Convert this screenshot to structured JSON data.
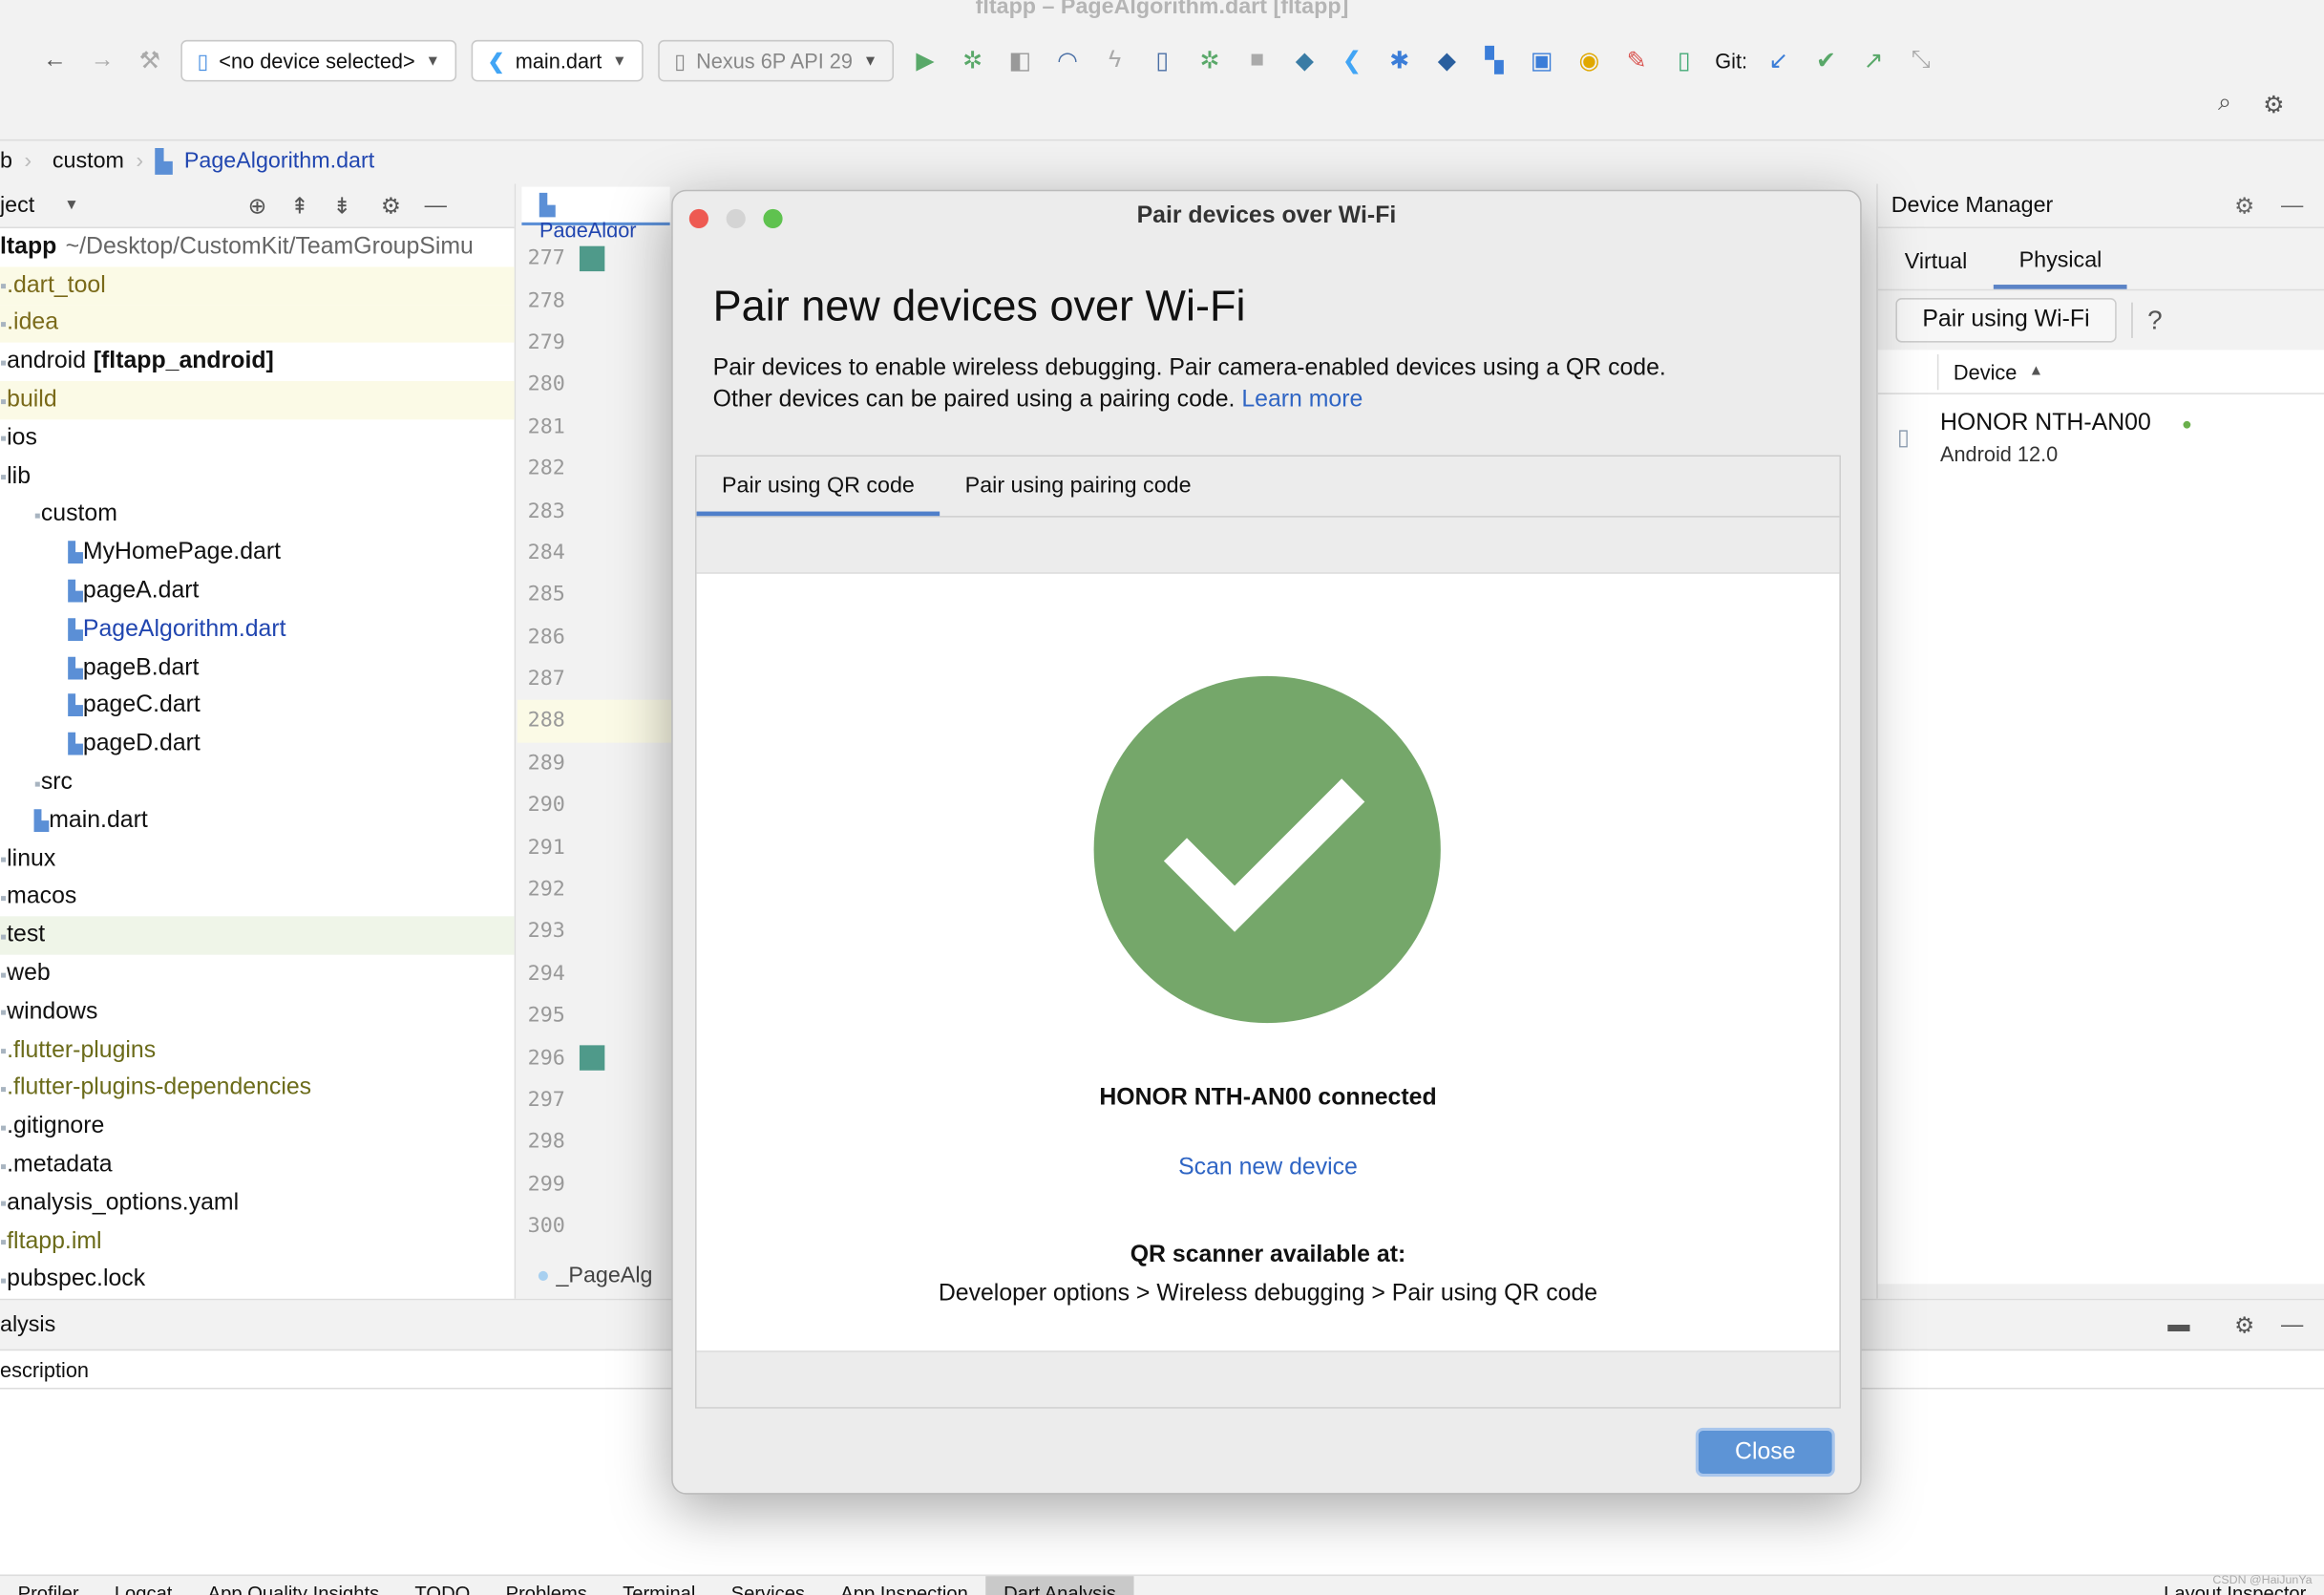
{
  "window_title": "fltapp – PageAlgorithm.dart [fltapp]",
  "toolbar": {
    "device_select": "<no device selected>",
    "run_config": "main.dart",
    "emulator": "Nexus 6P API 29",
    "git_label": "Git:",
    "icons": [
      "back-arrow-icon",
      "forward-arrow-icon",
      "build-icon",
      "run-icon",
      "debug-icon",
      "coverage-icon",
      "profile-icon",
      "hot-reload-icon",
      "device-file-icon",
      "attach-debugger-icon",
      "stop-icon",
      "gradle-sync-icon",
      "flutter-icon",
      "bug-icon",
      "dart-devtools-icon",
      "structure-icon",
      "sdk-manager-icon",
      "performance-icon",
      "clean-icon",
      "device-mirror-icon"
    ]
  },
  "breadcrumb": [
    "b",
    "custom",
    "PageAlgorithm.dart"
  ],
  "project_panel": {
    "title": "ject",
    "root_name": "ltapp",
    "root_path": "~/Desktop/CustomKit/TeamGroupSimu",
    "items": [
      {
        "label": ".dart_tool",
        "color": "#7a6a1a",
        "bg": "#fbfae6",
        "indent": 0
      },
      {
        "label": ".idea",
        "color": "#7a6a1a",
        "bg": "#fbfae6",
        "indent": 0
      },
      {
        "label": "android",
        "suffix": "[fltapp_android]",
        "color": "#111",
        "bg": "",
        "indent": 0
      },
      {
        "label": "build",
        "color": "#7a6a1a",
        "bg": "#fbfae6",
        "indent": 0
      },
      {
        "label": "ios",
        "color": "#111",
        "bg": "",
        "indent": 0
      },
      {
        "label": "lib",
        "color": "#111",
        "bg": "",
        "indent": 0
      },
      {
        "label": "custom",
        "color": "#111",
        "bg": "",
        "indent": 1
      },
      {
        "label": "MyHomePage.dart",
        "color": "#111",
        "bg": "",
        "indent": 2
      },
      {
        "label": "pageA.dart",
        "color": "#111",
        "bg": "",
        "indent": 2
      },
      {
        "label": "PageAlgorithm.dart",
        "color": "#2146b0",
        "bg": "",
        "indent": 2
      },
      {
        "label": "pageB.dart",
        "color": "#111",
        "bg": "",
        "indent": 2
      },
      {
        "label": "pageC.dart",
        "color": "#111",
        "bg": "",
        "indent": 2
      },
      {
        "label": "pageD.dart",
        "color": "#111",
        "bg": "",
        "indent": 2
      },
      {
        "label": "src",
        "color": "#111",
        "bg": "",
        "indent": 1
      },
      {
        "label": "main.dart",
        "color": "#111",
        "bg": "",
        "indent": 1
      },
      {
        "label": "linux",
        "color": "#111",
        "bg": "",
        "indent": 0
      },
      {
        "label": "macos",
        "color": "#111",
        "bg": "",
        "indent": 0
      },
      {
        "label": "test",
        "color": "#111",
        "bg": "#eff5e8",
        "indent": 0
      },
      {
        "label": "web",
        "color": "#111",
        "bg": "",
        "indent": 0
      },
      {
        "label": "windows",
        "color": "#111",
        "bg": "",
        "indent": 0
      },
      {
        "label": ".flutter-plugins",
        "color": "#6b6b1a",
        "bg": "",
        "indent": 0
      },
      {
        "label": ".flutter-plugins-dependencies",
        "color": "#6b6b1a",
        "bg": "",
        "indent": 0
      },
      {
        "label": ".gitignore",
        "color": "#111",
        "bg": "",
        "indent": 0
      },
      {
        "label": ".metadata",
        "color": "#111",
        "bg": "",
        "indent": 0
      },
      {
        "label": "analysis_options.yaml",
        "color": "#111",
        "bg": "",
        "indent": 0
      },
      {
        "label": "fltapp.iml",
        "color": "#6b6b1a",
        "bg": "",
        "indent": 0
      },
      {
        "label": "pubspec.lock",
        "color": "#111",
        "bg": "",
        "indent": 0
      }
    ]
  },
  "editor": {
    "tab": "PageAlgor",
    "bottom_tab": "_PageAlg",
    "line_numbers": [
      "277",
      "278",
      "279",
      "280",
      "281",
      "282",
      "283",
      "284",
      "285",
      "286",
      "287",
      "288",
      "289",
      "290",
      "291",
      "292",
      "293",
      "294",
      "295",
      "296",
      "297",
      "298",
      "299",
      "300"
    ]
  },
  "device_manager": {
    "title": "Device Manager",
    "tabs": [
      "Virtual",
      "Physical"
    ],
    "active_tab": "Physical",
    "pair_button": "Pair using Wi-Fi",
    "help": "?",
    "column": "Device",
    "devices": [
      {
        "name": "HONOR NTH-AN00",
        "os": "Android 12.0",
        "status_color": "#6ab04c"
      }
    ]
  },
  "bottom_panel": {
    "title": "alysis",
    "column": "escription",
    "tabs": [
      "Profiler",
      "Logcat",
      "App Quality Insights",
      "TODO",
      "Problems",
      "Terminal",
      "Services",
      "App Inspection",
      "Dart Analysis"
    ],
    "active_tab": "Dart Analysis",
    "right_tab": "Layout Inspector",
    "watermark": "CSDN @HaiJunYa"
  },
  "dialog": {
    "title": "Pair devices over Wi-Fi",
    "heading": "Pair new devices over Wi-Fi",
    "description_line1": "Pair devices to enable wireless debugging. Pair camera-enabled devices using a QR code.",
    "description_line2": "Other devices can be paired using a pairing code.",
    "learn_more": "Learn more",
    "tabs": [
      "Pair using QR code",
      "Pair using pairing code"
    ],
    "active_tab": "Pair using QR code",
    "success_color": "#75a76a",
    "status": "HONOR NTH-AN00 connected",
    "scan_new": "Scan new device",
    "qr_title": "QR scanner available at:",
    "qr_path": "Developer options > Wireless debugging > Pair using QR code",
    "close_button": "Close"
  }
}
